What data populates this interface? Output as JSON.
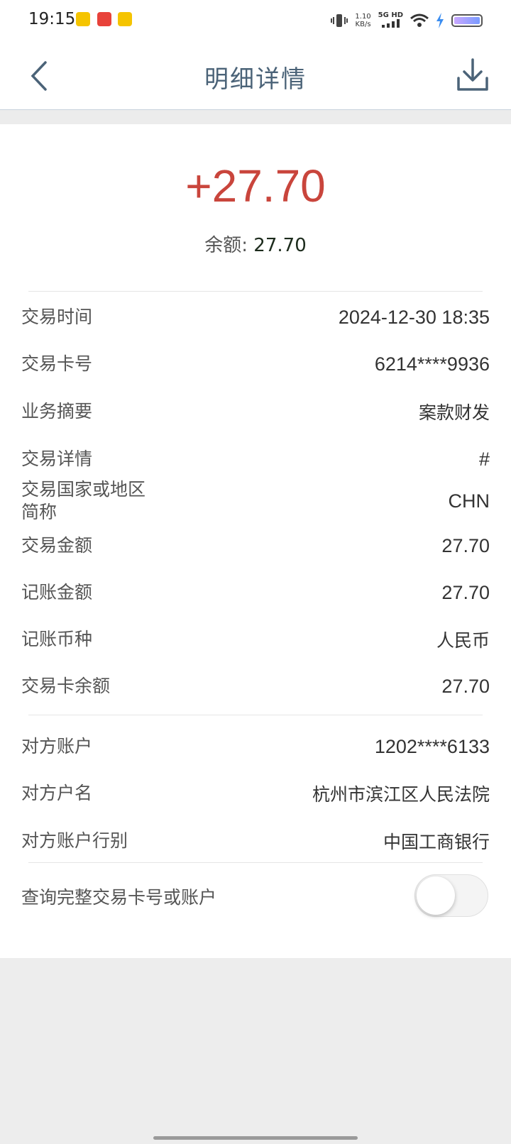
{
  "status_bar": {
    "time": "19:15",
    "net_speed": "1.10",
    "net_speed_unit": "KB/s",
    "network": "5G HD"
  },
  "header": {
    "title": "明细详情",
    "back_icon": "chevron-left-icon",
    "download_icon": "download-icon"
  },
  "summary": {
    "amount": "+27.70",
    "balance_label": "余额:",
    "balance_value": "27.70",
    "amount_color": "#c9453c"
  },
  "details": [
    {
      "label": "交易时间",
      "value": "2024-12-30 18:35"
    },
    {
      "label": "交易卡号",
      "value": "6214****9936"
    },
    {
      "label": "业务摘要",
      "value": "案款财发"
    },
    {
      "label": "交易详情",
      "value": "#"
    },
    {
      "label": "交易国家或地区",
      "label2": "简称",
      "value": "CHN"
    },
    {
      "label": "交易金额",
      "value": "27.70"
    },
    {
      "label": "记账金额",
      "value": "27.70"
    },
    {
      "label": "记账币种",
      "value": "人民币"
    },
    {
      "label": "交易卡余额",
      "value": "27.70"
    }
  ],
  "counterparty": [
    {
      "label": "对方账户",
      "value": "1202****6133"
    },
    {
      "label": "对方户名",
      "value": "杭州市滨江区人民法院"
    },
    {
      "label": "对方账户行别",
      "value": "中国工商银行"
    }
  ],
  "toggle": {
    "label": "查询完整交易卡号或账户",
    "state": "off"
  }
}
